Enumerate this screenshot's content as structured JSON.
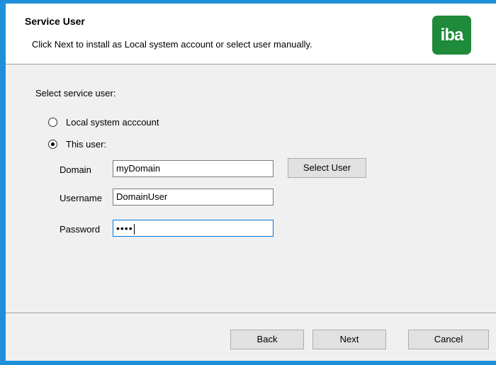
{
  "header": {
    "title": "Service User",
    "subtitle": "Click Next to install as Local system account or select user manually.",
    "logo_text": "iba",
    "logo_color": "#1f8a3a"
  },
  "body": {
    "select_label": "Select service user:",
    "options": [
      {
        "label": "Local system acccount",
        "selected": false
      },
      {
        "label": "This user:",
        "selected": true
      }
    ],
    "fields": {
      "domain": {
        "label": "Domain",
        "value": "myDomain"
      },
      "username": {
        "label": "Username",
        "value": "DomainUser"
      },
      "password": {
        "label": "Password",
        "masked_value": "••••"
      }
    },
    "select_user_label": "Select User"
  },
  "footer": {
    "back_label": "Back",
    "next_label": "Next",
    "cancel_label": "Cancel"
  },
  "colors": {
    "accent_border": "#1e8fd8"
  }
}
